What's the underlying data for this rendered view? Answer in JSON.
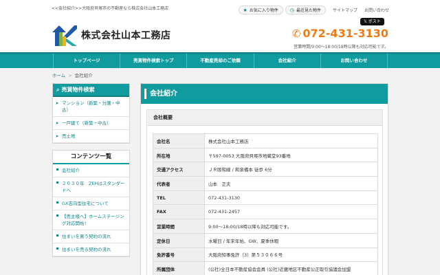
{
  "topbar": {
    "tagline": "<<会社紹介>>大阪府貝塚市の不動産なら株式会社山本工務店",
    "favorites_label": "お気に入り物件",
    "recent_label": "最近見た物件",
    "sitemap_label": "サイトマップ",
    "contact_label": "お問い合わせ"
  },
  "header": {
    "company_name": "株式会社山本工務店",
    "x_post_label": "ポスト",
    "phone": "072-431-3130",
    "hours": "営業時間/9:00～18:00/18時以降も対応可能です。"
  },
  "nav": {
    "items": [
      "トップページ",
      "売買物件検索トップ",
      "不動産売却のご依頼",
      "会社紹介",
      "お問い合わせ"
    ]
  },
  "breadcrumb": {
    "home": "ホーム",
    "separator": ">",
    "current": "会社紹介"
  },
  "sidebar": {
    "search_title": "売買物件検索",
    "search_items": [
      "マンション（新築・分譲・中古）",
      "一戸建て（新築・中古）",
      "売土地"
    ],
    "contents_title": "コンテンツ一覧",
    "contents_items": [
      "会社紹介",
      "２０３０年　ZEHはスタンダードへ",
      "GX志向型住宅について",
      "【売主様へ】ホームステージング対応開始！",
      "住まいを買う契約の流れ",
      "住まいを売る契約の流れ"
    ]
  },
  "main": {
    "title": "会社紹介",
    "section_title": "会社概要",
    "rows": [
      {
        "label": "会社名",
        "value": "株式会社山本工務店"
      },
      {
        "label": "所在地",
        "value": "〒597-0053 大阪府貝塚市地蔵堂93番地"
      },
      {
        "label": "交通アクセス",
        "value": "ＪＲ阪和線 / 和泉橋本 徒歩 6分"
      },
      {
        "label": "代表者",
        "value": "山本　正夫"
      },
      {
        "label": "TEL",
        "value": "072-431-3130"
      },
      {
        "label": "FAX",
        "value": "072-431-2457"
      },
      {
        "label": "営業時間",
        "value": "9:00～18:00/18時以降も対応可能です。"
      },
      {
        "label": "定休日",
        "value": "水曜日 / 年末年始、GW、夏季休暇"
      },
      {
        "label": "免許番号",
        "value": "大阪府知事免許（3）第５３０６６号"
      },
      {
        "label": "所属団体",
        "value": "(公社)全日本不動産協会会員 (公社)近畿地区不動産公正取引協議会加盟"
      }
    ]
  },
  "colors": {
    "accent": "#109b9e",
    "phone": "#f07b14"
  }
}
